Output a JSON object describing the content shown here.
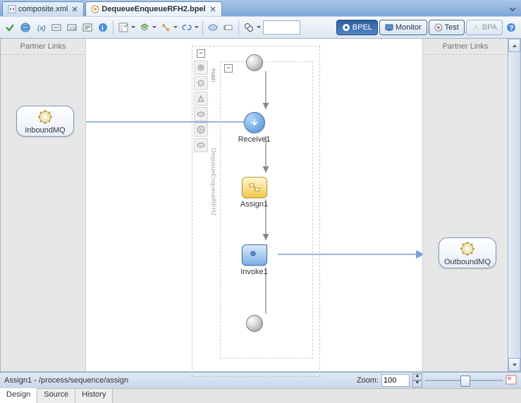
{
  "tabs": {
    "items": [
      {
        "label": "composite.xml",
        "active": false
      },
      {
        "label": "DequeueEnqueueRFH2.bpel",
        "active": true
      }
    ]
  },
  "toolbar": {
    "search_placeholder": ""
  },
  "modes": {
    "bpel": "BPEL",
    "monitor": "Monitor",
    "test": "Test",
    "bpa": "BPA"
  },
  "left_lane_title": "Partner Links",
  "right_lane_title": "Partner Links",
  "partners": {
    "inbound": "InboundMQ",
    "outbound": "OutboundMQ"
  },
  "flow_labels": {
    "main": "main",
    "process": "DequeueEnqueueRFH2"
  },
  "activities": {
    "receive": "Receive1",
    "assign": "Assign1",
    "invoke": "Invoke1"
  },
  "status": {
    "selection": "Assign1 - /process/sequence/assign",
    "zoom_label": "Zoom:",
    "zoom_value": "100"
  },
  "bottom_tabs": {
    "design": "Design",
    "source": "Source",
    "history": "History"
  }
}
